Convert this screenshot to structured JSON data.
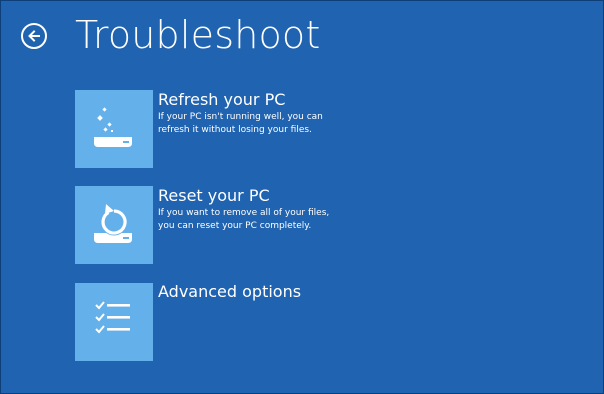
{
  "header": {
    "title": "Troubleshoot",
    "back_icon": "back-arrow-icon"
  },
  "options": [
    {
      "title": "Refresh your PC",
      "description_lines": [
        "If your PC isn't running well, you can",
        "refresh it without losing your files."
      ],
      "icon": "refresh-pc-icon"
    },
    {
      "title": "Reset your PC",
      "description_lines": [
        "If you want to remove all of your files,",
        "you can reset your PC completely."
      ],
      "icon": "reset-pc-icon"
    },
    {
      "title": "Advanced options",
      "description_lines": [],
      "icon": "checklist-icon"
    }
  ],
  "colors": {
    "background": "#1f63b1",
    "tile": "#63b0ea",
    "text": "#ffffff"
  }
}
